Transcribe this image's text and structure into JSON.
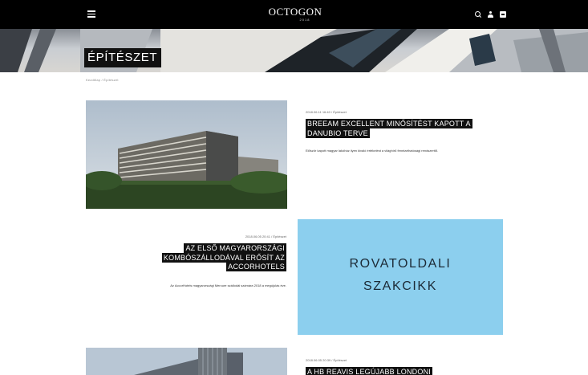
{
  "header": {
    "logo": "OCTOGON",
    "logo_sub": "2018",
    "icons": [
      "menu-icon",
      "search-icon",
      "user-icon",
      "cart-icon"
    ]
  },
  "hero": {
    "title": "ÉPÍTÉSZET"
  },
  "breadcrumb": {
    "home": "Kezdőlap",
    "separator": " / ",
    "current": "Építészet"
  },
  "articles": [
    {
      "date": "2018.06.11 16:40",
      "separator": " / ",
      "category": "Építészet",
      "title_line1": "BREEAM EXCELLENT MINŐSÍTÉST KAPOTT A",
      "title_line2": "DANUBIO TERVE",
      "lead": "Először kapott magyar lakóház ilyen kiváló értékelést a világhírű fenntarthatósági rendszertől."
    },
    {
      "date": "2018.06.05 20:41",
      "separator": " / ",
      "category": "Építészet",
      "title_line1": "AZ ELSŐ MAGYARORSZÁGI",
      "title_line2": "KOMBÓSZÁLLODÁVAL ERŐSÍT AZ",
      "title_line3": "ACCORHOTELS",
      "lead": "Az AccorHotels magyarországi Mercure szállodái számára 2018 a megújulás éve."
    },
    {
      "date": "2018.06.05 20:39",
      "separator": " / ",
      "category": "Építészet",
      "title_line1": "A HB REAVIS LEGÚJABB LONDONI"
    }
  ],
  "ad": {
    "line1": "ROVATOLDALI",
    "line2": "SZAKCIKK"
  },
  "colors": {
    "topbar": "#000000",
    "headline_bg": "#111111",
    "ad_bg": "#8ccfee"
  }
}
